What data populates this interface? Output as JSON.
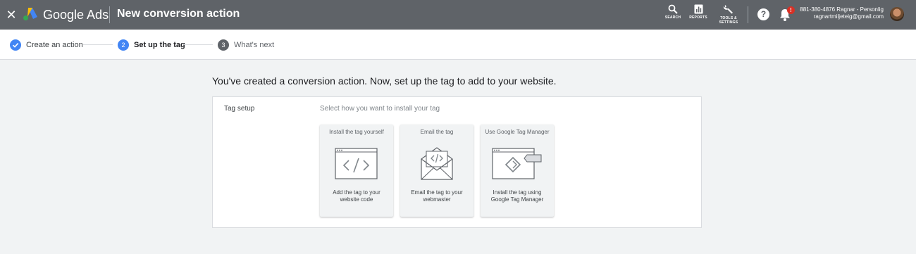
{
  "topbar": {
    "brand": "Google Ads",
    "page_title": "New conversion action",
    "tools": {
      "search": "SEARCH",
      "reports": "REPORTS",
      "settings_line1": "TOOLS &",
      "settings_line2": "SETTINGS"
    },
    "help_glyph": "?",
    "notification_badge": "!",
    "account": {
      "name": "881-380-4876 Ragnar - Personlig",
      "email": "ragnartmiljeteig@gmail.com"
    },
    "icons": {
      "close": "close-icon",
      "search": "search-icon",
      "reports": "bar-chart-icon",
      "settings": "wrench-icon",
      "help": "help-icon",
      "notifications": "bell-icon"
    }
  },
  "stepper": {
    "steps": [
      {
        "number": "1",
        "label": "Create an action",
        "state": "done"
      },
      {
        "number": "2",
        "label": "Set up the tag",
        "state": "current"
      },
      {
        "number": "3",
        "label": "What's next",
        "state": "future"
      }
    ]
  },
  "main": {
    "heading": "You've created a conversion action. Now, set up the tag to add to your website.",
    "card": {
      "label": "Tag setup",
      "hint": "Select how you want to install your tag",
      "options": [
        {
          "title": "Install the tag yourself",
          "desc": "Add the tag to your website code",
          "icon": "code-window-icon"
        },
        {
          "title": "Email the tag",
          "desc": "Email the tag to your webmaster",
          "icon": "email-code-icon"
        },
        {
          "title": "Use Google Tag Manager",
          "desc": "Install the tag using Google Tag Manager",
          "icon": "tag-manager-icon"
        }
      ]
    }
  },
  "colors": {
    "topbar": "#5f6368",
    "accent": "#4285f4",
    "background": "#f1f3f4",
    "badge": "#d93025"
  }
}
